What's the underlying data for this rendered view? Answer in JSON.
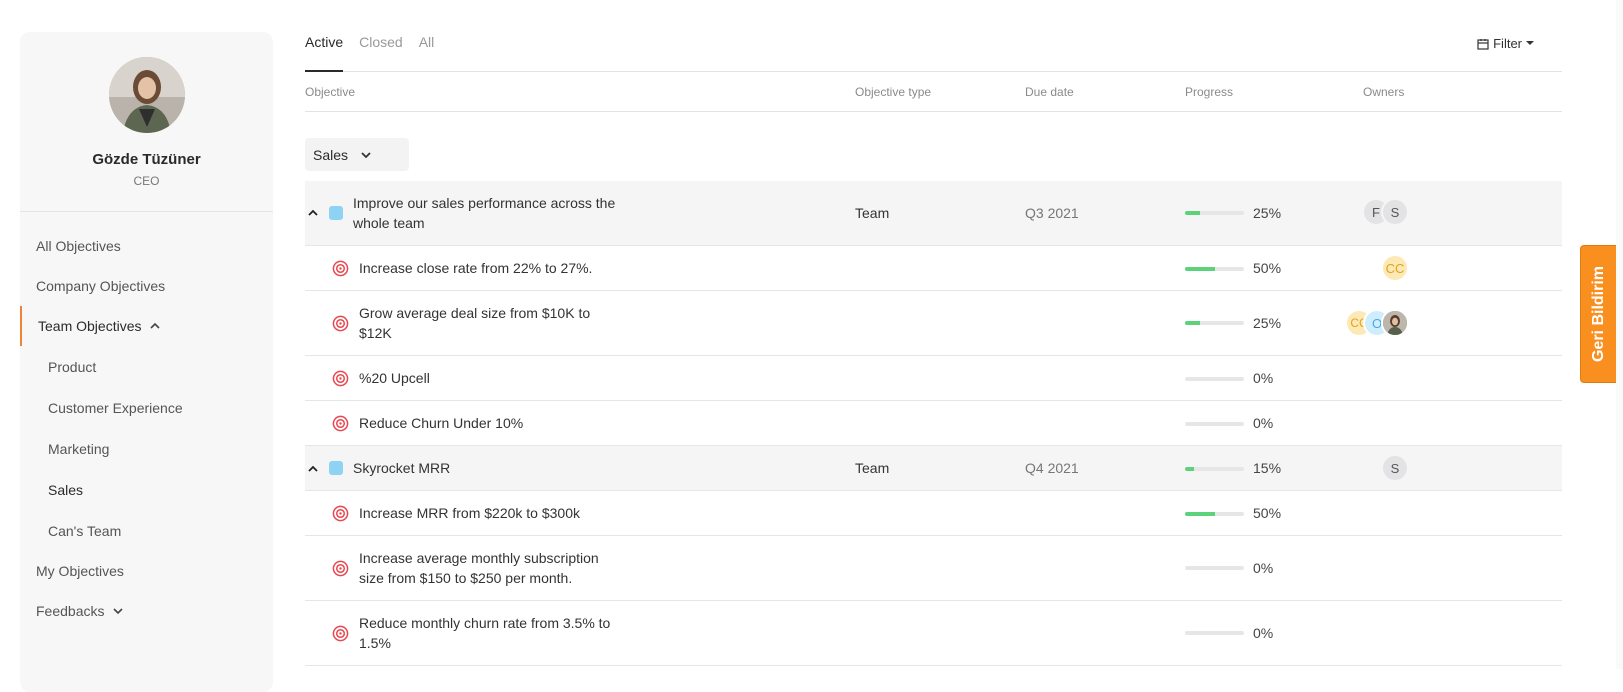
{
  "profile": {
    "name": "Gözde Tüzüner",
    "role": "CEO"
  },
  "nav": {
    "all": "All Objectives",
    "company": "Company Objectives",
    "team": "Team Objectives",
    "sub": [
      "Product",
      "Customer Experience",
      "Marketing",
      "Sales",
      "Can's Team"
    ],
    "my": "My Objectives",
    "feedbacks": "Feedbacks"
  },
  "tabs": [
    "Active",
    "Closed",
    "All"
  ],
  "filter_label": "Filter",
  "columns": {
    "objective": "Objective",
    "type": "Objective type",
    "due": "Due date",
    "progress": "Progress",
    "owners": "Owners"
  },
  "group": "Sales",
  "rows": [
    {
      "kind": "parent",
      "title_l1": "Improve our sales performance across the",
      "title_l2": "whole team",
      "type": "Team",
      "due": "Q3 2021",
      "progress": 25,
      "pct": "25%",
      "owners": [
        "F",
        "S"
      ]
    },
    {
      "kind": "child",
      "title_l1": "Increase close rate from 22% to 27%.",
      "progress": 50,
      "pct": "50%",
      "owners": [
        "CC"
      ]
    },
    {
      "kind": "child",
      "title_l1": "Grow average deal size from $10K to",
      "title_l2": "$12K",
      "progress": 25,
      "pct": "25%",
      "owners": [
        "CC",
        "O",
        "photo"
      ]
    },
    {
      "kind": "child",
      "title_l1": "%20 Upcell",
      "progress": 0,
      "pct": "0%",
      "owners": []
    },
    {
      "kind": "child",
      "title_l1": "Reduce Churn Under 10%",
      "progress": 0,
      "pct": "0%",
      "owners": []
    },
    {
      "kind": "parent",
      "title_l1": "Skyrocket MRR",
      "type": "Team",
      "due": "Q4 2021",
      "progress": 15,
      "pct": "15%",
      "owners": [
        "S"
      ]
    },
    {
      "kind": "child",
      "title_l1": "Increase MRR from $220k to $300k",
      "progress": 50,
      "pct": "50%",
      "owners": []
    },
    {
      "kind": "child",
      "title_l1": "Increase average monthly subscription",
      "title_l2": "size from $150 to $250 per month.",
      "progress": 0,
      "pct": "0%",
      "owners": []
    },
    {
      "kind": "child",
      "title_l1": "Reduce monthly churn rate from 3.5% to",
      "title_l2": "1.5%",
      "progress": 0,
      "pct": "0%",
      "owners": []
    }
  ],
  "feedback_label": "Geri Bildirim",
  "colors": {
    "accent": "#f08538",
    "progress": "#5cd27a",
    "feedback": "#f98f1e",
    "square": "#8fd3f4",
    "target": "#e9474f"
  }
}
